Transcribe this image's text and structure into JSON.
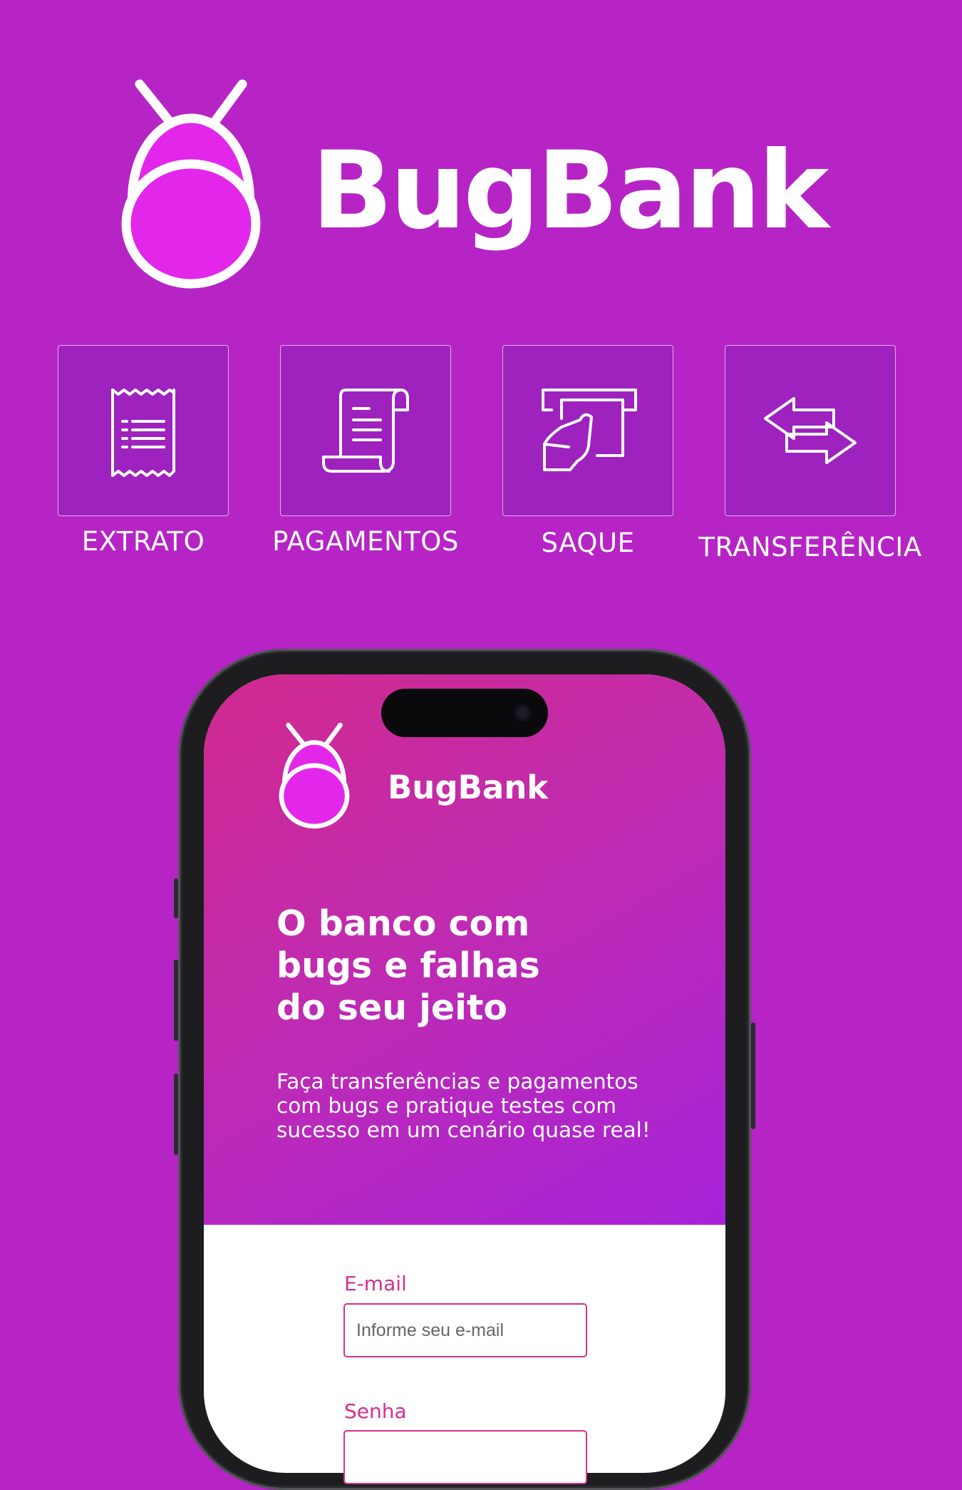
{
  "brand": {
    "name": "BugBank"
  },
  "features": [
    {
      "label": "EXTRATO",
      "icon": "receipt-icon"
    },
    {
      "label": "PAGAMENTOS",
      "icon": "scroll-document-icon"
    },
    {
      "label": "SAQUE",
      "icon": "cash-withdrawal-icon"
    },
    {
      "label": "TRANSFERÊNCIA",
      "icon": "transfer-arrows-icon"
    }
  ],
  "phone": {
    "app_name": "BugBank",
    "headline": [
      "O banco com",
      "bugs e falhas",
      "do seu jeito"
    ],
    "subtext": [
      "Faça transferências e pagamentos",
      "com bugs e pratique testes com",
      "sucesso em um cenário quase real!"
    ],
    "email": {
      "label": "E-mail",
      "placeholder": "Informe seu e-mail"
    },
    "password": {
      "label": "Senha"
    }
  },
  "colors": {
    "background": "#B624C6",
    "tile": "#9E22BE",
    "bug_body": "#E327EA",
    "field_accent": "#D62F8F"
  }
}
